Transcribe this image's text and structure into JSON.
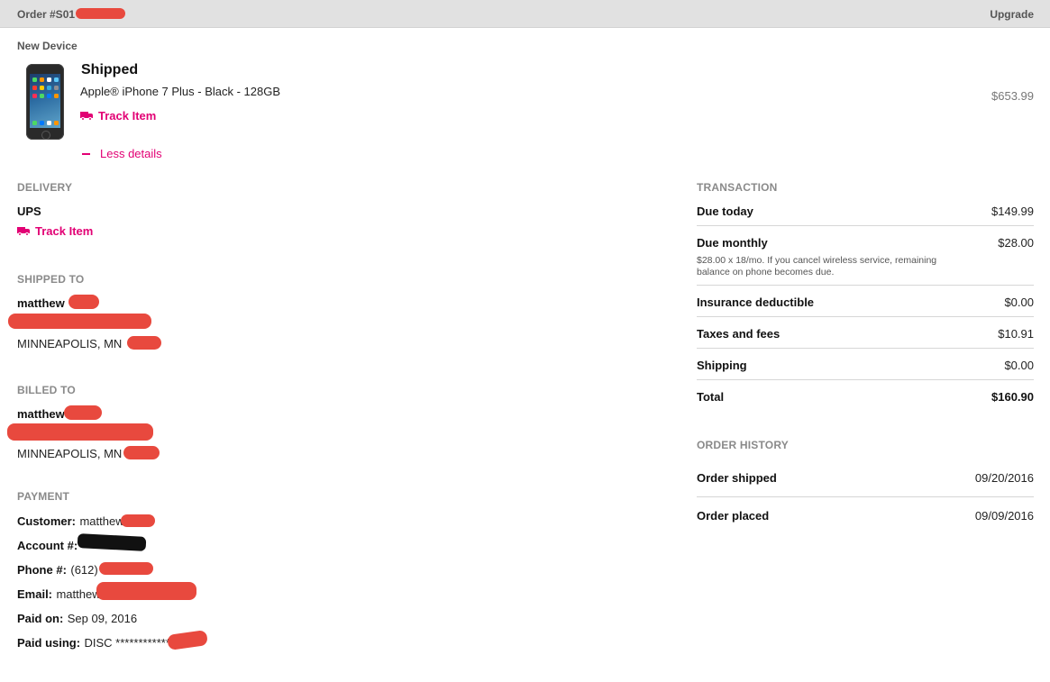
{
  "header": {
    "order_number": "Order #S01",
    "upgrade": "Upgrade"
  },
  "device": {
    "section_label": "New Device",
    "status": "Shipped",
    "product": "Apple® iPhone 7 Plus - Black - 128GB",
    "track_label": "Track Item",
    "price": "$653.99",
    "less_details": "Less details"
  },
  "delivery": {
    "label": "DELIVERY",
    "carrier": "UPS",
    "track_label": "Track Item"
  },
  "shipped_to": {
    "label": "SHIPPED TO",
    "name": "matthew",
    "city": "MINNEAPOLIS, MN"
  },
  "billed_to": {
    "label": "BILLED TO",
    "name": "matthew",
    "city": "MINNEAPOLIS, MN"
  },
  "payment": {
    "label": "PAYMENT",
    "rows": [
      {
        "key": "Customer:",
        "value": "matthew"
      },
      {
        "key": "Account #:",
        "value": ""
      },
      {
        "key": "Phone #:",
        "value": "(612)"
      },
      {
        "key": "Email:",
        "value": "matthew"
      },
      {
        "key": "Paid on:",
        "value": "Sep 09, 2016"
      },
      {
        "key": "Paid using:",
        "value": "DISC ************"
      }
    ]
  },
  "transaction": {
    "label": "TRANSACTION",
    "rows": [
      {
        "label": "Due today",
        "value": "$149.99"
      },
      {
        "label": "Due monthly",
        "value": "$28.00",
        "note": "$28.00 x 18/mo. If you cancel wireless service, remaining balance on phone becomes due."
      },
      {
        "label": "Insurance deductible",
        "value": "$0.00"
      },
      {
        "label": "Taxes and fees",
        "value": "$10.91"
      },
      {
        "label": "Shipping",
        "value": "$0.00"
      },
      {
        "label": "Total",
        "value": "$160.90"
      }
    ]
  },
  "order_history": {
    "label": "ORDER HISTORY",
    "rows": [
      {
        "label": "Order shipped",
        "date": "09/20/2016"
      },
      {
        "label": "Order placed",
        "date": "09/09/2016"
      }
    ]
  },
  "colors": {
    "accent": "#e20074",
    "header_bg": "#e1e1e1",
    "redaction": "#e8493e"
  },
  "icons": {
    "truck": "truck-icon",
    "minus": "minus-icon",
    "phone": "phone-image"
  }
}
